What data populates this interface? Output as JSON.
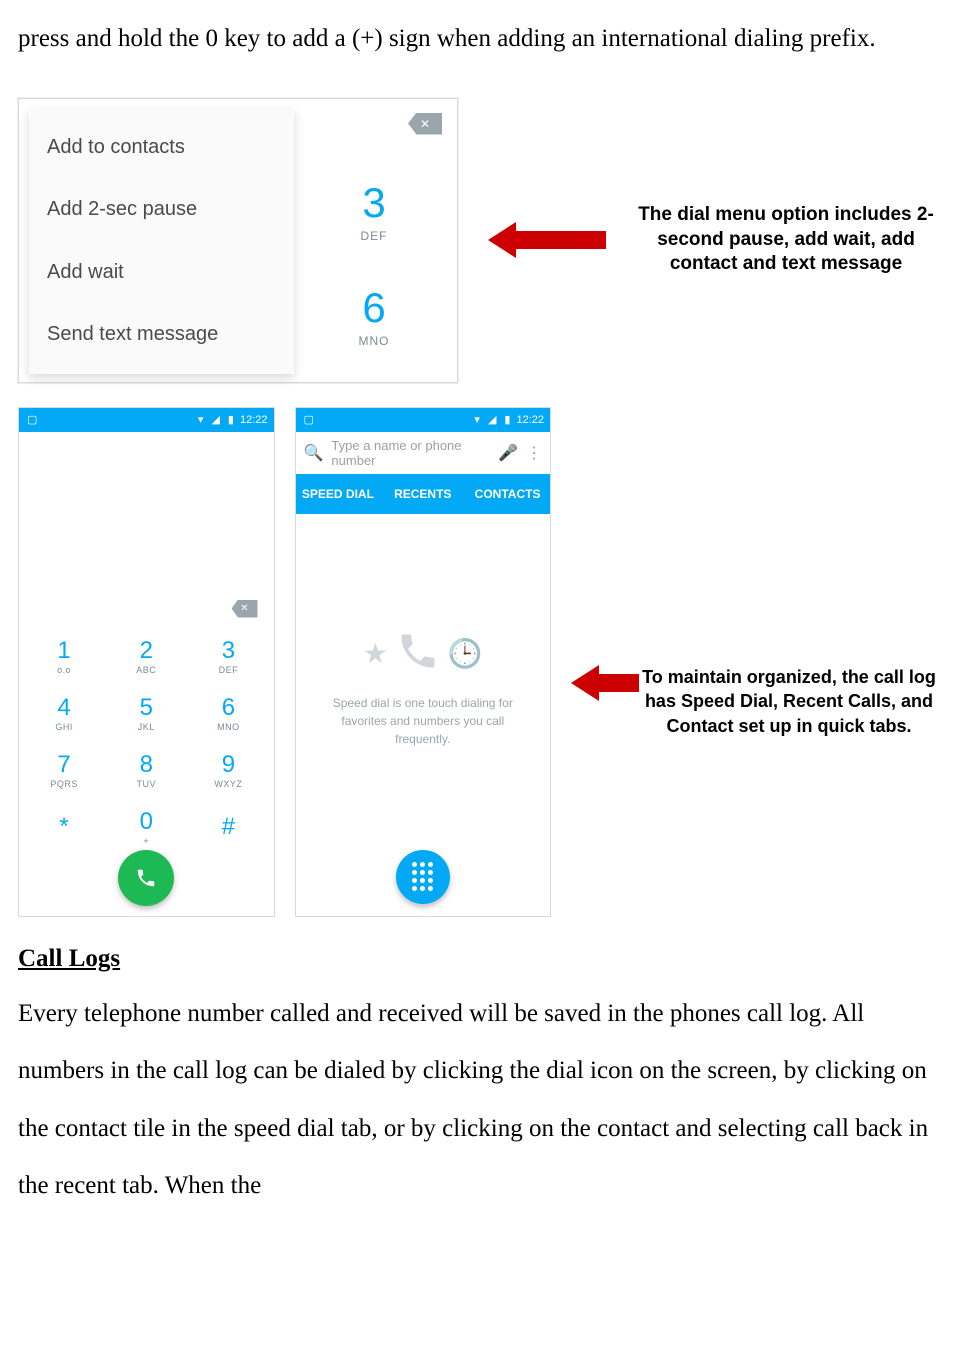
{
  "intro_text": "press and hold the 0 key to add a (+) sign when adding an international dialing prefix.",
  "menu": {
    "items": [
      "Add to contacts",
      "Add 2-sec pause",
      "Add wait",
      "Send text message"
    ],
    "key3": {
      "num": "3",
      "sub": "DEF"
    },
    "key6": {
      "num": "6",
      "sub": "MNO"
    }
  },
  "callout1": "The dial menu option includes 2-second pause, add wait, add contact and text message",
  "status": {
    "time": "12:22"
  },
  "keypad": [
    {
      "n": "1",
      "l": "o.o"
    },
    {
      "n": "2",
      "l": "ABC"
    },
    {
      "n": "3",
      "l": "DEF"
    },
    {
      "n": "4",
      "l": "GHI"
    },
    {
      "n": "5",
      "l": "JKL"
    },
    {
      "n": "6",
      "l": "MNO"
    },
    {
      "n": "7",
      "l": "PQRS"
    },
    {
      "n": "8",
      "l": "TUV"
    },
    {
      "n": "9",
      "l": "WXYZ"
    },
    {
      "n": "*",
      "l": ""
    },
    {
      "n": "0",
      "l": "+"
    },
    {
      "n": "#",
      "l": ""
    }
  ],
  "search_placeholder": "Type a name or phone number",
  "tabs": {
    "a": "SPEED DIAL",
    "b": "RECENTS",
    "c": "CONTACTS"
  },
  "speed_msg": "Speed dial is one touch dialing for favorites and numbers you call frequently.",
  "callout2": "To maintain organized, the call log has Speed Dial, Recent Calls, and Contact set up in quick tabs.",
  "section_title": "Call Logs",
  "section_body": "Every telephone number called and received will be saved in the phones call log. All numbers in the call log can be dialed by clicking the dial icon on the screen, by clicking on the contact tile in the speed dial tab, or by clicking on the contact and selecting call back in the recent tab. When the"
}
